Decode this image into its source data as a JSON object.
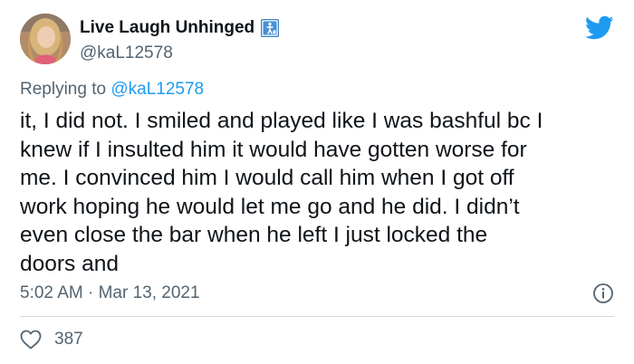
{
  "author": {
    "display_name": "Live Laugh Unhinged",
    "handle": "@kaL12578",
    "badge": "accessibility-figure-icon",
    "avatar": "profile-photo"
  },
  "reply": {
    "prefix": "Replying to ",
    "mention": "@kaL12578"
  },
  "tweet": {
    "lines": [
      "it, I did not. I smiled and played like I was bashful bc I",
      "knew if I insulted him it would have gotten worse for",
      "me. I convinced him I would call him when I got off",
      "work hoping he would let me go and he did. I didn’t",
      "even close the bar when he left I just locked the",
      "doors and"
    ]
  },
  "meta": {
    "timestamp": "5:02 AM · Mar 13, 2021"
  },
  "stats": {
    "likes": "387"
  },
  "colors": {
    "brand_blue": "#1d9bf0",
    "text": "#0f1419",
    "muted": "#536471",
    "divider": "#cfd9de"
  },
  "icons": {
    "logo": "twitter-bird-icon",
    "info": "info-icon",
    "like": "heart-icon"
  }
}
